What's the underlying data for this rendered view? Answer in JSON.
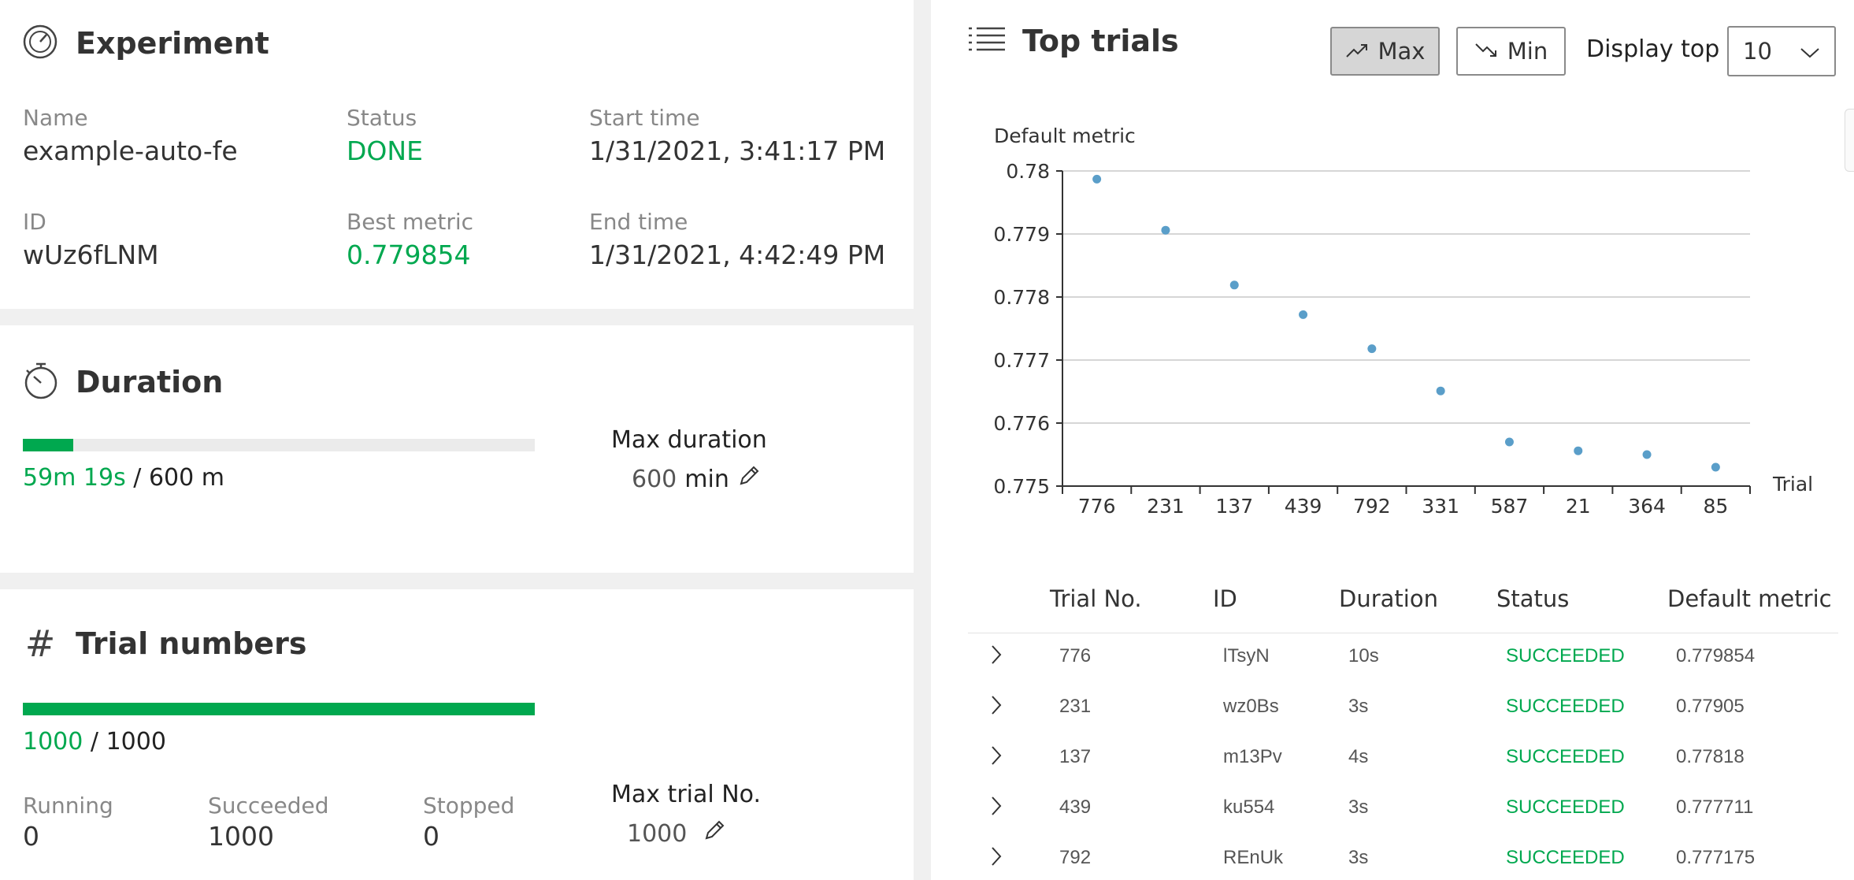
{
  "experiment": {
    "title": "Experiment",
    "name_label": "Name",
    "name_value": "example-auto-fe",
    "status_label": "Status",
    "status_value": "DONE",
    "start_label": "Start time",
    "start_value": "1/31/2021, 3:41:17 PM",
    "id_label": "ID",
    "id_value": "wUz6fLNM",
    "best_label": "Best metric",
    "best_value": "0.779854",
    "end_label": "End time",
    "end_value": "1/31/2021, 4:42:49 PM"
  },
  "duration": {
    "title": "Duration",
    "elapsed": "59m 19s",
    "separator": "/",
    "total": "600 m",
    "progress": 0.0989,
    "max_label": "Max duration",
    "max_value": "600",
    "max_unit": "min"
  },
  "trials": {
    "title": "Trial numbers",
    "done": "1000",
    "separator": "/",
    "total": "1000",
    "progress": 1.0,
    "running_label": "Running",
    "running_value": "0",
    "succeeded_label": "Succeeded",
    "succeeded_value": "1000",
    "stopped_label": "Stopped",
    "stopped_value": "0",
    "max_label": "Max trial No.",
    "max_value": "1000"
  },
  "top_trials": {
    "title": "Top trials",
    "max_button": "Max",
    "min_button": "Min",
    "display_top_label": "Display top",
    "display_top_value": "10",
    "columns": [
      "Trial No.",
      "ID",
      "Duration",
      "Status",
      "Default metric"
    ],
    "rows": [
      {
        "trial": "776",
        "id": "lTsyN",
        "duration": "10s",
        "status": "SUCCEEDED",
        "metric": "0.779854"
      },
      {
        "trial": "231",
        "id": "wz0Bs",
        "duration": "3s",
        "status": "SUCCEEDED",
        "metric": "0.77905"
      },
      {
        "trial": "137",
        "id": "m13Pv",
        "duration": "4s",
        "status": "SUCCEEDED",
        "metric": "0.77818"
      },
      {
        "trial": "439",
        "id": "ku554",
        "duration": "3s",
        "status": "SUCCEEDED",
        "metric": "0.777711"
      },
      {
        "trial": "792",
        "id": "REnUk",
        "duration": "3s",
        "status": "SUCCEEDED",
        "metric": "0.777175"
      }
    ]
  },
  "chart_data": {
    "type": "scatter",
    "ylabel": "Default metric",
    "xlabel": "Trial",
    "categories": [
      "776",
      "231",
      "137",
      "439",
      "792",
      "331",
      "587",
      "21",
      "364",
      "85"
    ],
    "values": [
      0.77987,
      0.77906,
      0.77819,
      0.77772,
      0.77718,
      0.77651,
      0.7757,
      0.77556,
      0.7755,
      0.7753
    ],
    "ylim": [
      0.775,
      0.78
    ],
    "yticks": [
      "0.775",
      "0.776",
      "0.777",
      "0.778",
      "0.779",
      "0.78"
    ],
    "grid": true,
    "marker_color": "#5a9ec9"
  }
}
